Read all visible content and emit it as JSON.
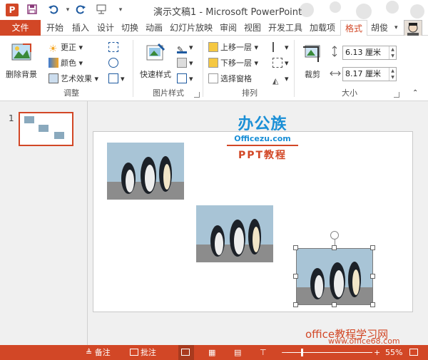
{
  "window": {
    "title": "演示文稿1 - Microsoft PowerPoint",
    "app_icon": "P"
  },
  "quick_access": [
    "save-icon",
    "undo-icon",
    "redo-icon",
    "present-icon"
  ],
  "tabs": [
    {
      "label": "文件"
    },
    {
      "label": "开始"
    },
    {
      "label": "插入"
    },
    {
      "label": "设计"
    },
    {
      "label": "切换"
    },
    {
      "label": "动画"
    },
    {
      "label": "幻灯片放映"
    },
    {
      "label": "审阅"
    },
    {
      "label": "视图"
    },
    {
      "label": "开发工具"
    },
    {
      "label": "加载项"
    },
    {
      "label": "格式"
    }
  ],
  "user": {
    "name": "胡俊"
  },
  "ribbon": {
    "adjust": {
      "label": "调整",
      "remove_bg": "删除背景",
      "corrections": "更正",
      "color": "颜色",
      "artistic": "艺术效果"
    },
    "picture_styles": {
      "label": "图片样式",
      "quick_styles": "快速样式"
    },
    "arrange": {
      "label": "排列",
      "bring_forward": "上移一层",
      "send_backward": "下移一层",
      "selection_pane": "选择窗格"
    },
    "size": {
      "label": "大小",
      "crop": "裁剪",
      "height": "6.13 厘米",
      "width": "8.17 厘米"
    }
  },
  "thumbnails": [
    {
      "number": "1"
    }
  ],
  "logo": {
    "top": "办公族",
    "mid": "Officezu.com",
    "bottom": "PPT教程"
  },
  "statusbar": {
    "notes": "备注",
    "comments": "批注",
    "zoom": "55%"
  },
  "watermark": {
    "line1": "office教程学习网",
    "line2": "www.office68.com"
  },
  "colors": {
    "accent": "#d24726",
    "logo_blue": "#1a8fd6"
  }
}
